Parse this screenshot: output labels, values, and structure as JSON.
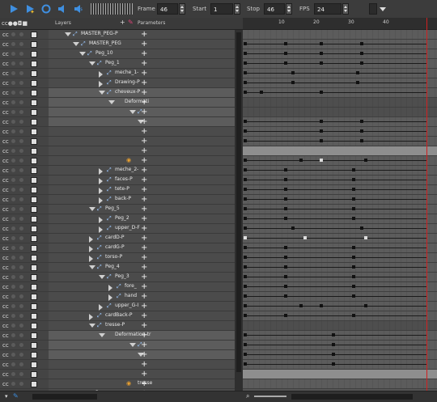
{
  "toolbar": {
    "frame_label": "Frame",
    "frame_value": "46",
    "start_label": "Start",
    "start_value": "1",
    "stop_label": "Stop",
    "stop_value": "46",
    "fps_label": "FPS",
    "fps_value": "24"
  },
  "header": {
    "layers_label": "Layers",
    "parameters_label": "Parameters"
  },
  "ruler": [
    "10",
    "20",
    "30",
    "40"
  ],
  "layers": [
    {
      "name": "MASTER_PEG-P",
      "indent": 80,
      "toggle": "down",
      "peg": true
    },
    {
      "name": "MASTER_PEG",
      "indent": 90,
      "toggle": "down",
      "peg": true
    },
    {
      "name": "Peg_10",
      "indent": 98,
      "toggle": "down",
      "peg": true
    },
    {
      "name": "Peg_1",
      "indent": 110,
      "toggle": "down",
      "peg": true
    },
    {
      "name": "meche_1-",
      "indent": 122,
      "toggle": "right",
      "peg": true
    },
    {
      "name": "Drawing-P",
      "indent": 122,
      "toggle": "right",
      "peg": true
    },
    {
      "name": "cheveux-P",
      "indent": 122,
      "toggle": "down",
      "peg": true,
      "sel": true
    },
    {
      "name": "Deformati",
      "indent": 134,
      "toggle": "down",
      "peg": false,
      "sel": true
    },
    {
      "name": "",
      "indent": 160,
      "toggle": "down",
      "peg": true,
      "sel": true
    },
    {
      "name": "",
      "indent": 170,
      "toggle": "down",
      "peg": false,
      "sel": true
    },
    {
      "name": "",
      "indent": 0,
      "toggle": "",
      "peg": false
    },
    {
      "name": "",
      "indent": 0,
      "toggle": "",
      "peg": false
    },
    {
      "name": "",
      "indent": 0,
      "toggle": "",
      "peg": false
    },
    {
      "name": "",
      "indent": 0,
      "toggle": "",
      "peg": false,
      "special": "1"
    },
    {
      "name": "meche_2-",
      "indent": 122,
      "toggle": "right",
      "peg": true
    },
    {
      "name": "faces-P",
      "indent": 122,
      "toggle": "right",
      "peg": true
    },
    {
      "name": "tete-P",
      "indent": 122,
      "toggle": "right",
      "peg": true
    },
    {
      "name": "back-P",
      "indent": 122,
      "toggle": "right",
      "peg": true
    },
    {
      "name": "Peg_5",
      "indent": 110,
      "toggle": "down",
      "peg": true
    },
    {
      "name": "Peg_2",
      "indent": 122,
      "toggle": "right",
      "peg": true
    },
    {
      "name": "upper_D-F",
      "indent": 122,
      "toggle": "right",
      "peg": true
    },
    {
      "name": "cardD-P",
      "indent": 110,
      "toggle": "right",
      "peg": true
    },
    {
      "name": "cardG-P",
      "indent": 110,
      "toggle": "right",
      "peg": true
    },
    {
      "name": "torso-P",
      "indent": 110,
      "toggle": "right",
      "peg": true
    },
    {
      "name": "Peg_4",
      "indent": 110,
      "toggle": "down",
      "peg": true
    },
    {
      "name": "Peg_3",
      "indent": 122,
      "toggle": "down",
      "peg": true
    },
    {
      "name": "fore_",
      "indent": 134,
      "toggle": "right",
      "peg": true
    },
    {
      "name": "hand",
      "indent": 134,
      "toggle": "right",
      "peg": true
    },
    {
      "name": "upper_G-I",
      "indent": 122,
      "toggle": "right",
      "peg": true
    },
    {
      "name": "cardBack-P",
      "indent": 110,
      "toggle": "right",
      "peg": true
    },
    {
      "name": "tresse-P",
      "indent": 110,
      "toggle": "down",
      "peg": true
    },
    {
      "name": "Deformation-tr",
      "indent": 122,
      "toggle": "down",
      "peg": false,
      "sel": true
    },
    {
      "name": "",
      "indent": 160,
      "toggle": "down",
      "peg": true,
      "sel": true
    },
    {
      "name": "",
      "indent": 170,
      "toggle": "down",
      "peg": false,
      "sel": true
    },
    {
      "name": "",
      "indent": 0,
      "toggle": "",
      "peg": false
    },
    {
      "name": "",
      "indent": 0,
      "toggle": "",
      "peg": false
    },
    {
      "name": "tresse",
      "indent": 150,
      "toggle": "",
      "peg": false,
      "special": "1"
    },
    {
      "name": "Peg",
      "indent": 98,
      "toggle": "down",
      "peg": true
    }
  ],
  "timeline": {
    "frames_total": 46,
    "rows": [
      {
        "keys": [],
        "bar": false
      },
      {
        "keys": [
          1,
          11,
          20,
          30
        ],
        "bar": false
      },
      {
        "keys": [
          1,
          11,
          20,
          30
        ],
        "bar": false
      },
      {
        "keys": [
          1,
          11,
          20,
          30
        ],
        "bar": false
      },
      {
        "keys": [
          1,
          13,
          29
        ],
        "bar": false
      },
      {
        "keys": [
          1,
          13,
          29
        ],
        "bar": false
      },
      {
        "keys": [
          1,
          5,
          20
        ],
        "bar": false
      },
      {
        "keys": [],
        "bar": false,
        "dark": true
      },
      {
        "keys": [],
        "bar": false,
        "dark": true
      },
      {
        "keys": [
          1,
          20,
          30
        ],
        "bar": false
      },
      {
        "keys": [
          1,
          20,
          30
        ],
        "bar": false
      },
      {
        "keys": [
          1,
          20,
          30
        ],
        "bar": false
      },
      {
        "keys": [],
        "bar": true
      },
      {
        "keys": [
          1,
          15,
          20,
          31
        ],
        "bar": false,
        "white": [
          20
        ]
      },
      {
        "keys": [
          1,
          11,
          28
        ],
        "bar": false
      },
      {
        "keys": [
          1,
          11,
          28
        ],
        "bar": false
      },
      {
        "keys": [
          1,
          11,
          28
        ],
        "bar": false
      },
      {
        "keys": [
          1,
          11,
          28
        ],
        "bar": false
      },
      {
        "keys": [
          1,
          11,
          28
        ],
        "bar": false
      },
      {
        "keys": [
          1,
          11,
          28
        ],
        "bar": false
      },
      {
        "keys": [
          1,
          13,
          30
        ],
        "bar": false
      },
      {
        "keys": [
          1,
          16,
          31
        ],
        "bar": false,
        "white": [
          1,
          16,
          31
        ]
      },
      {
        "keys": [
          1,
          11,
          28
        ],
        "bar": false
      },
      {
        "keys": [
          1,
          11,
          28
        ],
        "bar": false
      },
      {
        "keys": [
          1,
          11,
          28
        ],
        "bar": false
      },
      {
        "keys": [
          1,
          11,
          28
        ],
        "bar": false
      },
      {
        "keys": [
          1,
          11,
          28
        ],
        "bar": false
      },
      {
        "keys": [
          1,
          11,
          28
        ],
        "bar": false
      },
      {
        "keys": [
          1,
          15,
          20,
          31
        ],
        "bar": false
      },
      {
        "keys": [
          1,
          11,
          28
        ],
        "bar": false
      },
      {
        "keys": [],
        "bar": false,
        "dark": true
      },
      {
        "keys": [
          1,
          23
        ],
        "bar": false
      },
      {
        "keys": [
          1,
          23
        ],
        "bar": false
      },
      {
        "keys": [
          1,
          23
        ],
        "bar": false
      },
      {
        "keys": [
          1,
          23
        ],
        "bar": false
      },
      {
        "keys": [],
        "bar": true
      },
      {
        "keys": [],
        "bar": false
      }
    ]
  }
}
